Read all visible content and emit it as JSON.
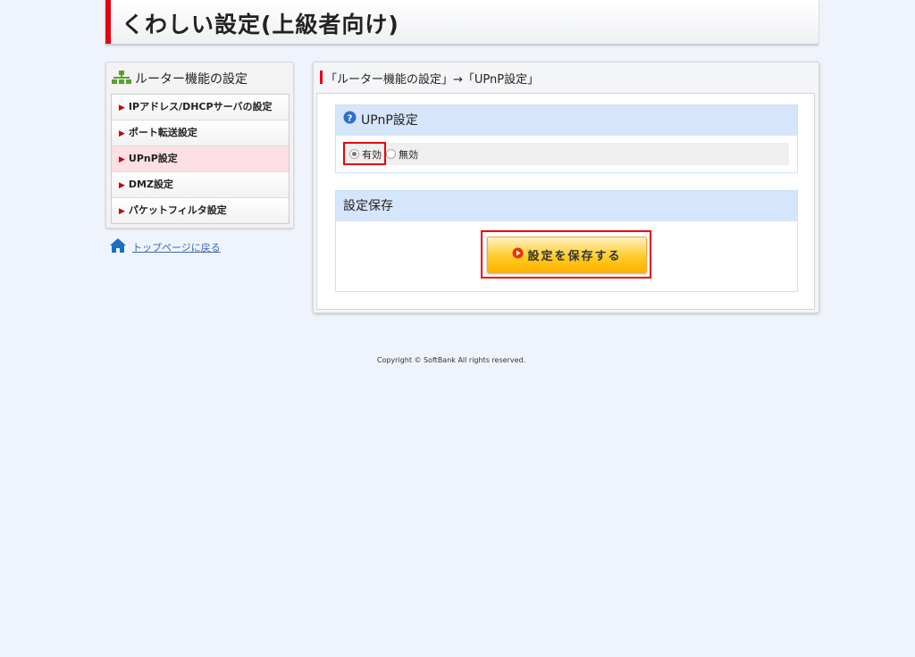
{
  "header": {
    "title": "くわしい設定(上級者向け)"
  },
  "sidebar": {
    "title": "ルーター機能の設定",
    "items": [
      {
        "label": "IPアドレス/DHCPサーバの設定"
      },
      {
        "label": "ポート転送設定"
      },
      {
        "label": "UPnP設定",
        "active": true
      },
      {
        "label": "DMZ設定"
      },
      {
        "label": "パケットフィルタ設定"
      }
    ],
    "home_link": "トップページに戻る"
  },
  "main": {
    "breadcrumb": "「ルーター機能の設定」→「UPnP設定」",
    "upnp": {
      "title": "UPnP設定",
      "options": [
        {
          "label": "有効",
          "selected": true
        },
        {
          "label": "無効",
          "selected": false
        }
      ]
    },
    "save": {
      "title": "設定保存",
      "button": "設定を保存する"
    }
  },
  "footer": {
    "copyright": "Copyright © SoftBank All rights reserved."
  },
  "colors": {
    "accent": "#e60012",
    "section_header": "#d5e5fb",
    "button": "#ffc820"
  }
}
